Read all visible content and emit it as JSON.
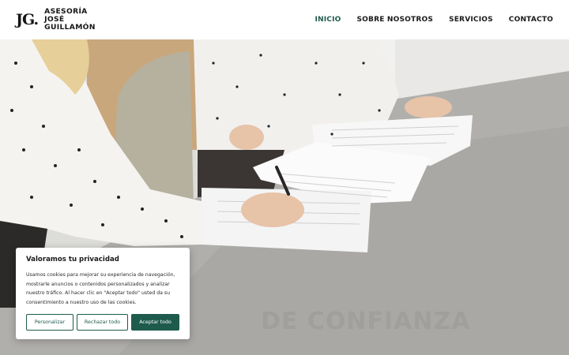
{
  "logo": {
    "mark": "JG.",
    "lines": [
      "ASESORÍA",
      "JOSÉ",
      "GUILLAMÓN"
    ]
  },
  "nav": {
    "items": [
      {
        "label": "INICIO",
        "active": true
      },
      {
        "label": "SOBRE NOSOTROS",
        "active": false
      },
      {
        "label": "SERVICIOS",
        "active": false
      },
      {
        "label": "CONTACTO",
        "active": false
      }
    ]
  },
  "hero": {
    "watermark_text": "DE CONFIANZA"
  },
  "cookie": {
    "title": "Valoramos tu privacidad",
    "body": "Usamos cookies para mejorar su experiencia de navegación, mostrarle anuncios o contenidos personalizados y analizar nuestro tráfico. Al hacer clic en \"Aceptar todo\" usted da su consentimiento a nuestro uso de las cookies.",
    "buttons": {
      "customize": "Personalizar",
      "reject": "Rechazar todo",
      "accept": "Aceptar todo"
    }
  },
  "colors": {
    "accent": "#1e5b4c",
    "text": "#1a1a1a"
  }
}
